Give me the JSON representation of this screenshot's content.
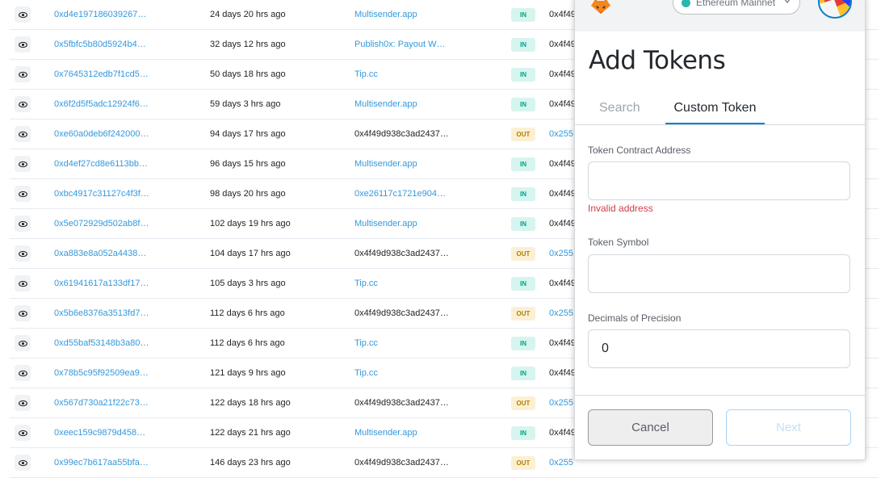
{
  "transactions": [
    {
      "hash": "0xd4e197186039267…",
      "age": "24 days 20 hrs ago",
      "from": "Multisender.app",
      "from_link": true,
      "direction": "IN",
      "to": "0x4f49"
    },
    {
      "hash": "0x5fbfc5b80d5924b4…",
      "age": "32 days 12 hrs ago",
      "from": "Publish0x: Payout W…",
      "from_link": true,
      "direction": "IN",
      "to": "0x4f49"
    },
    {
      "hash": "0x7645312edb7f1cd5…",
      "age": "50 days 18 hrs ago",
      "from": "Tip.cc",
      "from_link": true,
      "direction": "IN",
      "to": "0x4f49"
    },
    {
      "hash": "0x6f2d5f5adc12924f6…",
      "age": "59 days 3 hrs ago",
      "from": "Multisender.app",
      "from_link": true,
      "direction": "IN",
      "to": "0x4f49"
    },
    {
      "hash": "0xe60a0deb6f242000…",
      "age": "94 days 17 hrs ago",
      "from": "0x4f49d938c3ad2437…",
      "from_link": false,
      "direction": "OUT",
      "to": "0x255"
    },
    {
      "hash": "0xd4ef27cd8e6113bb…",
      "age": "96 days 15 hrs ago",
      "from": "Multisender.app",
      "from_link": true,
      "direction": "IN",
      "to": "0x4f49"
    },
    {
      "hash": "0xbc4917c31127c4f3f…",
      "age": "98 days 20 hrs ago",
      "from": "0xe26117c1721e904…",
      "from_link": true,
      "direction": "IN",
      "to": "0x4f49"
    },
    {
      "hash": "0x5e072929d502ab8f…",
      "age": "102 days 19 hrs ago",
      "from": "Multisender.app",
      "from_link": true,
      "direction": "IN",
      "to": "0x4f49"
    },
    {
      "hash": "0xa883e8a052a4438…",
      "age": "104 days 17 hrs ago",
      "from": "0x4f49d938c3ad2437…",
      "from_link": false,
      "direction": "OUT",
      "to": "0x255"
    },
    {
      "hash": "0x61941617a133df17…",
      "age": "105 days 3 hrs ago",
      "from": "Tip.cc",
      "from_link": true,
      "direction": "IN",
      "to": "0x4f49"
    },
    {
      "hash": "0x5b6e8376a3513fd7…",
      "age": "112 days 6 hrs ago",
      "from": "0x4f49d938c3ad2437…",
      "from_link": false,
      "direction": "OUT",
      "to": "0x255"
    },
    {
      "hash": "0xd55baf53148b3a80…",
      "age": "112 days 6 hrs ago",
      "from": "Tip.cc",
      "from_link": true,
      "direction": "IN",
      "to": "0x4f49"
    },
    {
      "hash": "0x78b5c95f92509ea9…",
      "age": "121 days 9 hrs ago",
      "from": "Tip.cc",
      "from_link": true,
      "direction": "IN",
      "to": "0x4f49"
    },
    {
      "hash": "0x567d730a21f22c73…",
      "age": "122 days 18 hrs ago",
      "from": "0x4f49d938c3ad2437…",
      "from_link": false,
      "direction": "OUT",
      "to": "0x255"
    },
    {
      "hash": "0xeec159c9879d458…",
      "age": "122 days 21 hrs ago",
      "from": "Multisender.app",
      "from_link": true,
      "direction": "IN",
      "to": "0x4f49"
    },
    {
      "hash": "0x99ec7b617aa55bfa…",
      "age": "146 days 23 hrs ago",
      "from": "0x4f49d938c3ad2437…",
      "from_link": false,
      "direction": "OUT",
      "to": "0x255"
    }
  ],
  "popup": {
    "network_label": "Ethereum Mainnet",
    "title": "Add Tokens",
    "tabs": {
      "search": "Search",
      "custom": "Custom Token"
    },
    "fields": {
      "contract_label": "Token Contract Address",
      "contract_value": "",
      "contract_error": "Invalid address",
      "symbol_label": "Token Symbol",
      "symbol_value": "",
      "decimals_label": "Decimals of Precision",
      "decimals_value": "0"
    },
    "buttons": {
      "cancel": "Cancel",
      "next": "Next"
    }
  },
  "colors": {
    "link": "#3498db",
    "accent": "#037dd6",
    "error": "#d73a49",
    "in_badge": "#d6f5ee",
    "out_badge": "#fbf0d4"
  }
}
